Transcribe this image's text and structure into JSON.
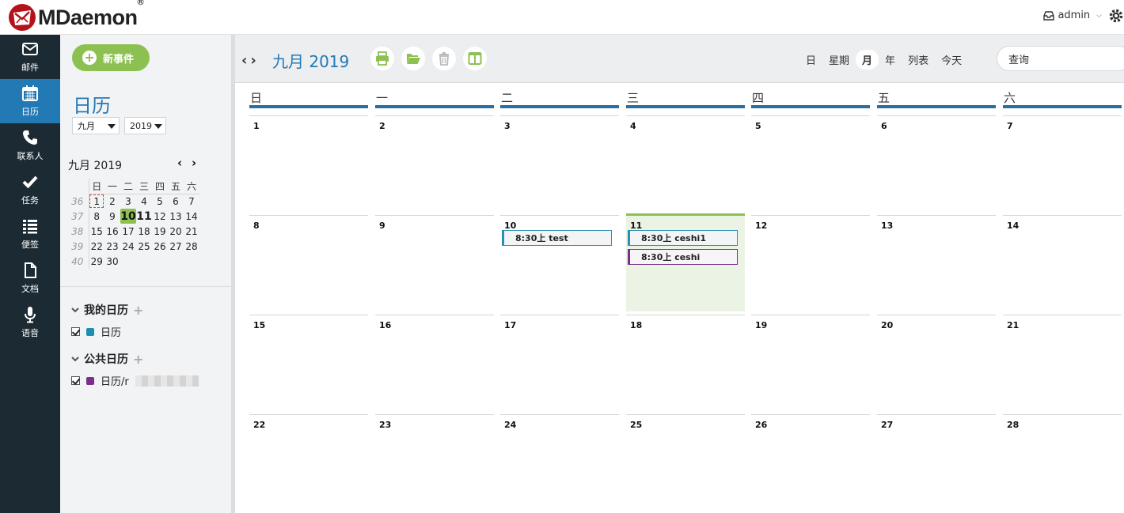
{
  "header": {
    "logo_text": "MDaemon",
    "logo_reg": "®",
    "user": "admin"
  },
  "nav": [
    {
      "label": "邮件",
      "icon": "mail-icon"
    },
    {
      "label": "日历",
      "icon": "calendar-icon"
    },
    {
      "label": "联系人",
      "icon": "phone-icon"
    },
    {
      "label": "任务",
      "icon": "check-icon"
    },
    {
      "label": "便签",
      "icon": "list-icon"
    },
    {
      "label": "文档",
      "icon": "document-icon"
    },
    {
      "label": "语音",
      "icon": "microphone-icon"
    }
  ],
  "panel": {
    "new_event": "新事件",
    "title": "日历",
    "month_select": "九月",
    "year_select": "2019",
    "mini_title": "九月 2019",
    "mini_dow": [
      "日",
      "一",
      "二",
      "三",
      "四",
      "五",
      "六"
    ],
    "mini_weeks": [
      {
        "wk": "36",
        "days": [
          "",
          "1",
          "2",
          "3",
          "4",
          "5",
          "6",
          "7"
        ]
      },
      {
        "wk": "37",
        "days": [
          "",
          "8",
          "9",
          "10",
          "11",
          "12",
          "13",
          "14"
        ]
      },
      {
        "wk": "38",
        "days": [
          "",
          "15",
          "16",
          "17",
          "18",
          "19",
          "20",
          "21"
        ]
      },
      {
        "wk": "39",
        "days": [
          "",
          "22",
          "23",
          "24",
          "25",
          "26",
          "27",
          "28"
        ]
      },
      {
        "wk": "40",
        "days": [
          "",
          "29",
          "30",
          "",
          "",
          "",
          "",
          ""
        ]
      }
    ],
    "my_calendars_label": "我的日历",
    "my_calendars": [
      {
        "name": "日历",
        "color": "#1b8fb0"
      }
    ],
    "public_calendars_label": "公共日历",
    "public_calendars": [
      {
        "name": "日历/r",
        "color": "#7a2f8a"
      }
    ]
  },
  "toolbar": {
    "prev": "‹",
    "next": "›",
    "month_title": "九月 2019",
    "views": [
      "日",
      "星期",
      "月",
      "年",
      "列表",
      "今天"
    ],
    "active_view": "月",
    "search_placeholder": "查询"
  },
  "month": {
    "dow": [
      "日",
      "一",
      "二",
      "三",
      "四",
      "五",
      "六"
    ],
    "weeks": [
      [
        "1",
        "2",
        "3",
        "4",
        "5",
        "6",
        "7"
      ],
      [
        "8",
        "9",
        "10",
        "11",
        "12",
        "13",
        "14"
      ],
      [
        "15",
        "16",
        "17",
        "18",
        "19",
        "20",
        "21"
      ],
      [
        "22",
        "23",
        "24",
        "25",
        "26",
        "27",
        "28"
      ]
    ],
    "today": "11",
    "events": [
      {
        "day": "10",
        "label": "8:30上 test",
        "color": "blue"
      },
      {
        "day": "11",
        "label": "8:30上 ceshi1",
        "color": "blue"
      },
      {
        "day": "11",
        "label": "8:30上 ceshi",
        "color": "purple"
      }
    ]
  }
}
